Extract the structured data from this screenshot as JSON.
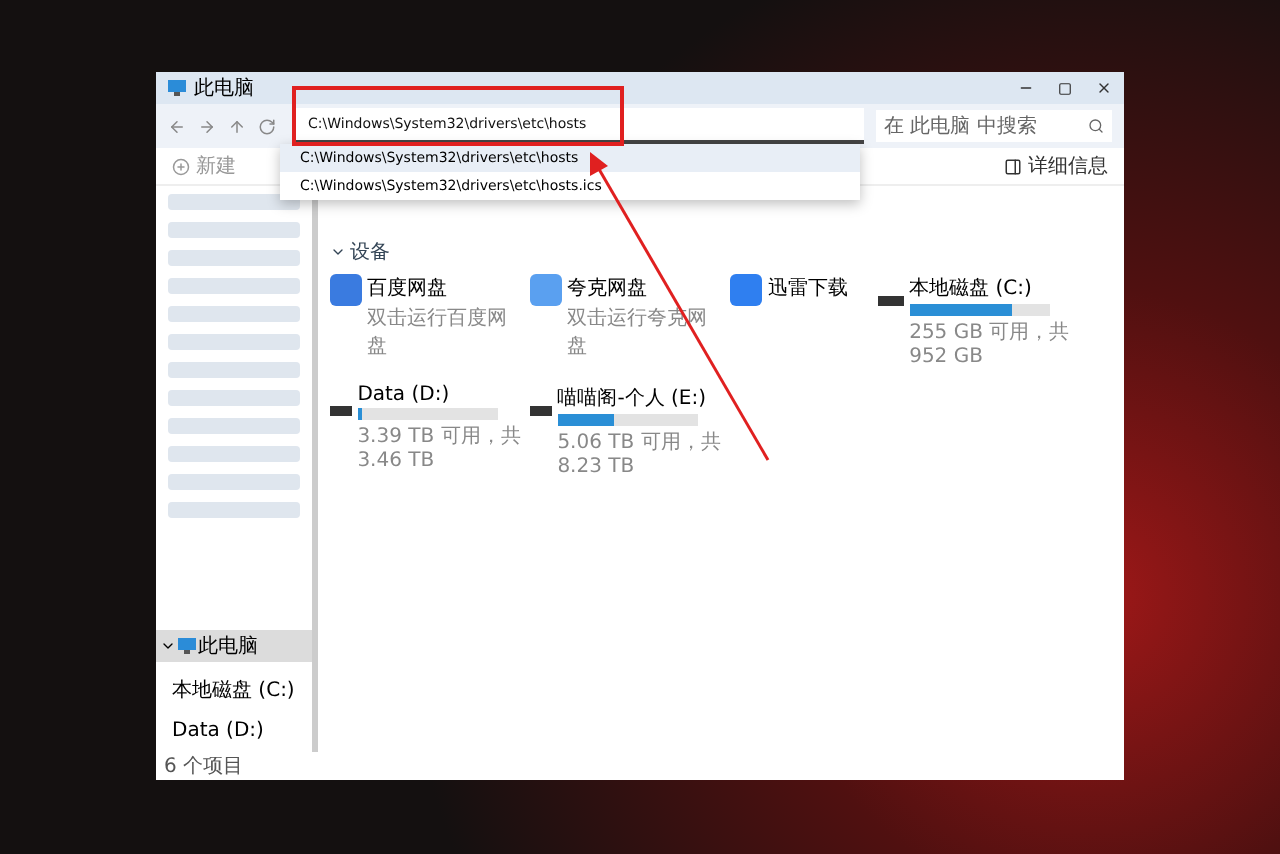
{
  "window": {
    "title": "此电脑"
  },
  "address": {
    "value": "C:\\Windows\\System32\\drivers\\etc\\hosts"
  },
  "suggestions": [
    {
      "text": "C:\\Windows\\System32\\drivers\\etc\\hosts",
      "selected": true
    },
    {
      "text": "C:\\Windows\\System32\\drivers\\etc\\hosts.ics",
      "selected": false
    }
  ],
  "search": {
    "placeholder": "在 此电脑 中搜索"
  },
  "toolbar": {
    "new": "新建",
    "details": "详细信息"
  },
  "section": "设备",
  "items": [
    {
      "kind": "app",
      "name": "百度网盘",
      "sub": "双击运行百度网盘"
    },
    {
      "kind": "app",
      "name": "夸克网盘",
      "sub": "双击运行夸克网盘"
    },
    {
      "kind": "app",
      "name": "迅雷下载"
    },
    {
      "kind": "drive",
      "name": "本地磁盘 (C:)",
      "level": 0.73,
      "usage": "255 GB 可用，共 952 GB"
    },
    {
      "kind": "drive",
      "name": "Data (D:)",
      "level": 0.03,
      "usage": "3.39 TB 可用，共 3.46 TB"
    },
    {
      "kind": "drive",
      "name": "喵喵阁-个人 (E:)",
      "level": 0.4,
      "usage": "5.06 TB 可用，共 8.23 TB"
    }
  ],
  "sidebar": [
    {
      "label": "此电脑",
      "selected": true,
      "expanded": true,
      "children": [
        {
          "label": "本地磁盘 (C:)",
          "selected": false
        },
        {
          "label": "Data (D:)",
          "selected": false
        }
      ]
    }
  ],
  "status": "6 个项目"
}
